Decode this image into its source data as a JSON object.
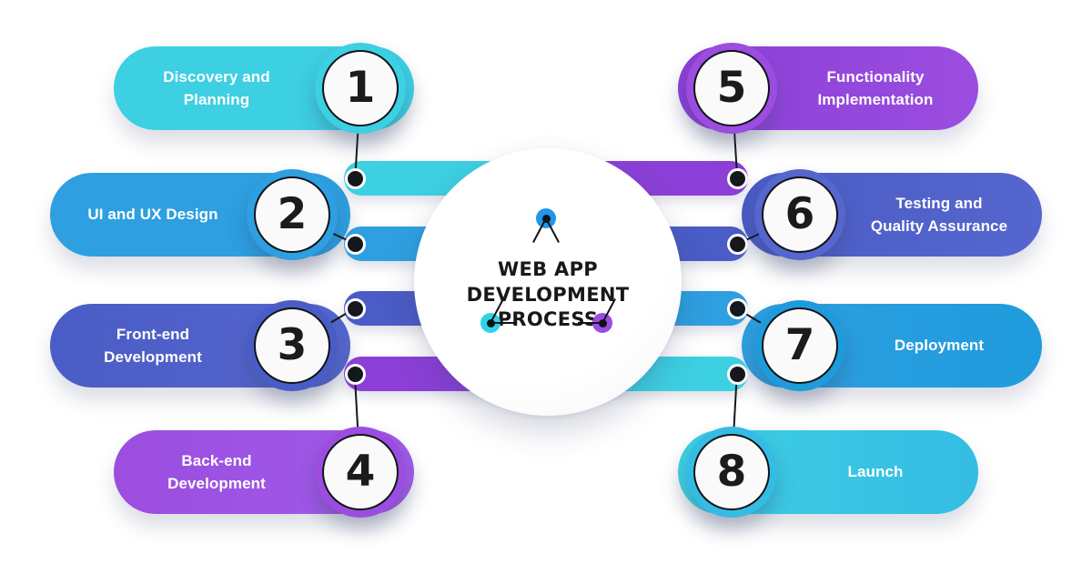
{
  "diagram": {
    "title": "WEB APP DEVELOPMENT\nPROCESS",
    "center_title_line1": "WEB APP DEVELOPMENT",
    "center_title_line2": "PROCESS",
    "type": "circular-process-infographic",
    "step_count": 8
  },
  "steps": [
    {
      "number": "1",
      "label": "Discovery and\nPlanning",
      "side": "left",
      "color": "#3DCFE2",
      "color_end": "#3DCFE2",
      "inner_bar_color": "#3DCFE2"
    },
    {
      "number": "2",
      "label": "UI and UX Design",
      "side": "left",
      "color": "#2E9FE0",
      "color_end": "#2E9FE0",
      "inner_bar_color": "#2E9FE0"
    },
    {
      "number": "3",
      "label": "Front-end\nDevelopment",
      "side": "left",
      "color": "#4A5CC5",
      "color_end": "#5566CE",
      "inner_bar_color": "#4A5CC5"
    },
    {
      "number": "4",
      "label": "Back-end\nDevelopment",
      "side": "left",
      "color": "#9B4DE0",
      "color_end": "#A05BE8",
      "inner_bar_color": "#8B3FD6"
    },
    {
      "number": "5",
      "label": "Functionality\nImplementation",
      "side": "right",
      "color": "#9B4DE0",
      "color_end": "#8B3FD6",
      "inner_bar_color": "#8B3FD6"
    },
    {
      "number": "6",
      "label": "Testing and\nQuality Assurance",
      "side": "right",
      "color": "#5566CE",
      "color_end": "#4A5CC5",
      "inner_bar_color": "#4A5CC5"
    },
    {
      "number": "7",
      "label": "Deployment",
      "side": "right",
      "color": "#1F9BDC",
      "color_end": "#2E9FE0",
      "inner_bar_color": "#2E9FE0"
    },
    {
      "number": "8",
      "label": "Launch",
      "side": "right",
      "color": "#35BCE4",
      "color_end": "#3DCFE2",
      "inner_bar_color": "#3DCFE2"
    }
  ],
  "hub_nodes": [
    {
      "name": "node-top",
      "color": "#2196E8"
    },
    {
      "name": "node-bottom-left",
      "color": "#2FD3E8"
    },
    {
      "name": "node-bottom-right",
      "color": "#9B4DE0"
    }
  ],
  "palette": {
    "cyan": "#3DCFE2",
    "blue": "#2E9FE0",
    "indigo": "#4A5CC5",
    "purple": "#9B4DE0",
    "ink": "#15181c",
    "text_on_color": "#ffffff",
    "background": "#ffffff"
  }
}
